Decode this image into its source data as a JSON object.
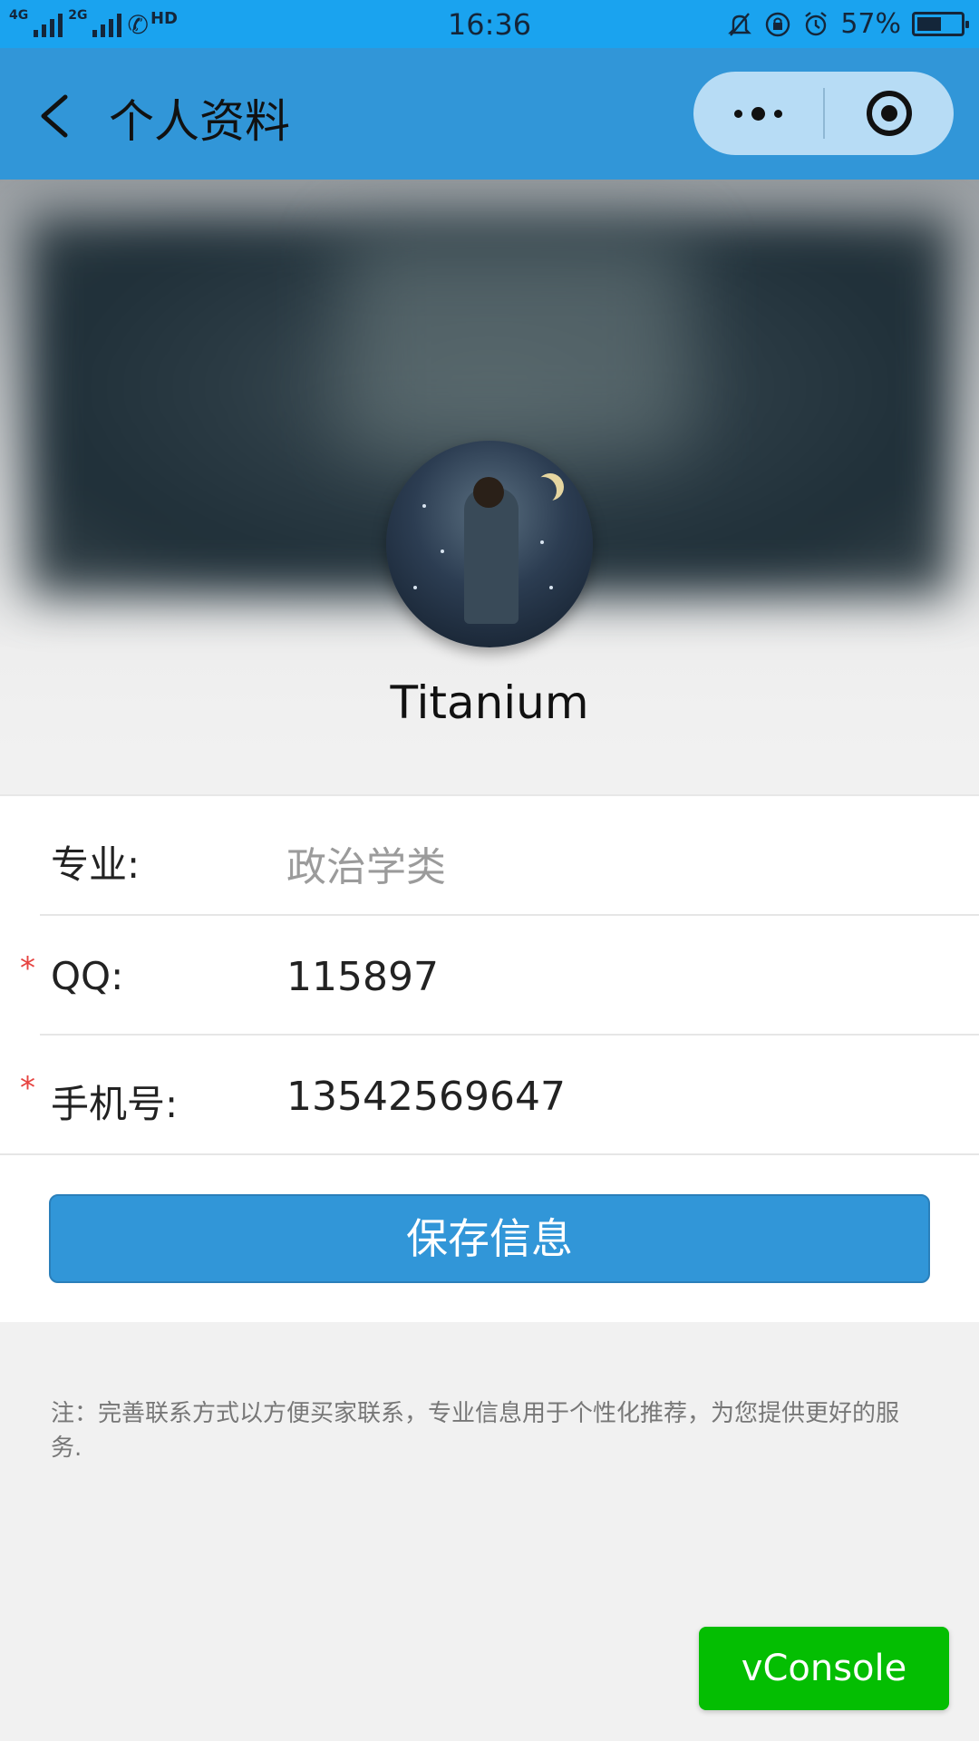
{
  "status_bar": {
    "network_tag_1": "4G",
    "network_tag_2": "2G",
    "hd_tag": "HD",
    "time": "16:36",
    "battery_percent": "57%",
    "battery_level": 0.57,
    "icons": [
      "mute-bell-icon",
      "rotation-lock-icon",
      "alarm-icon",
      "battery-icon"
    ]
  },
  "nav": {
    "title": "个人资料",
    "back_icon": "chevron-left-icon",
    "capsule_more_icon": "more-dots-icon",
    "capsule_close_icon": "target-circle-icon"
  },
  "profile": {
    "username": "Titanium"
  },
  "form": {
    "fields": [
      {
        "label": "专业:",
        "value": "政治学类",
        "required": false
      },
      {
        "label": "QQ:",
        "value": "115897",
        "required": true
      },
      {
        "label": "手机号:",
        "value": "13542569647",
        "required": true
      }
    ],
    "required_mark": "*",
    "save_label": "保存信息"
  },
  "note": "注：完善联系方式以方便买家联系，专业信息用于个性化推荐，为您提供更好的服务.",
  "vconsole_label": "vConsole",
  "colors": {
    "status_bar": "#1aa3ef",
    "nav_bar": "#3196d8",
    "required": "#e64340",
    "vconsole": "#04be02"
  }
}
